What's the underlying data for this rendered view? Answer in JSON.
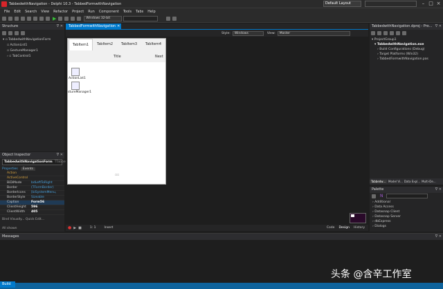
{
  "window": {
    "title": "TabbedwithNavigation - Delphi 10.3 - TabbedFormwithNavigation",
    "layout": "Default Layout"
  },
  "menu": [
    "File",
    "Edit",
    "Search",
    "View",
    "Refactor",
    "Project",
    "Run",
    "Component",
    "Tools",
    "Tabs",
    "Help"
  ],
  "toolbar": {
    "platform": "Windows 32-bit"
  },
  "structure": {
    "title": "Structure",
    "tree": [
      "TabbedwithNavigationForm",
      "ActionList1",
      "GestureManager1",
      "TabControl1"
    ]
  },
  "editor": {
    "file_tab": "TabbedFormwithNavigation",
    "style_label": "Style:",
    "style_value": "Windows",
    "view_label": "View:",
    "view_value": "Master",
    "tabs": [
      "TabItem1",
      "TabItem2",
      "TabItem3",
      "TabItem4"
    ],
    "nav_title": "Title",
    "nav_next": "Next",
    "components": [
      "ActionList1",
      "stureManager1"
    ],
    "bottom_tabs": [
      "Code",
      "Design",
      "History"
    ],
    "status_left": "1: 1",
    "status_mode": "Insert"
  },
  "object_inspector": {
    "title": "Object Inspector",
    "selected": "TabbedwithNavigationForm",
    "selected_type": "TTabbedwith",
    "tabs": [
      "Properties",
      "Events"
    ],
    "rows": [
      {
        "name": "Action",
        "value": ""
      },
      {
        "name": "ActiveControl",
        "value": ""
      },
      {
        "name": "BiDiMode",
        "value": "bdLeftToRight"
      },
      {
        "name": "Border",
        "value": "(TFormBorder)"
      },
      {
        "name": "BorderIcons",
        "value": "[biSystemMenu,"
      },
      {
        "name": "BorderStyle",
        "value": "Sizeable"
      },
      {
        "name": "Caption",
        "value": "Form56"
      },
      {
        "name": "ClientHeight",
        "value": "596"
      },
      {
        "name": "ClientWidth",
        "value": "405"
      }
    ],
    "footer_link": "Bind Visually...  Quick Edit...",
    "footer_status": "All shown"
  },
  "project": {
    "title": "TabbedwithNavigation.dproj - Pro...",
    "items": [
      "ProjectGroup1",
      "TabbedwithNavigation.exe",
      "Build Configurations (Debug)",
      "Target Platforms (Win32)",
      "TabbedFormwithNavigation.pas"
    ],
    "bottom_tabs": [
      "Tabbedw...",
      "Model Vi...",
      "Data Expl...",
      "Multi-De..."
    ]
  },
  "palette": {
    "title": "Palette",
    "items": [
      "Additional",
      "Data Access",
      "Datasnap Client",
      "Datasnap Server",
      "dbExpress",
      "Dialogs"
    ]
  },
  "messages": {
    "title": "Messages"
  },
  "build_tab": "Build",
  "watermark": "头条 @含辛工作室",
  "colors": {
    "accent": "#007acc",
    "run": "#38c038",
    "app_icon": "#d9252a"
  }
}
